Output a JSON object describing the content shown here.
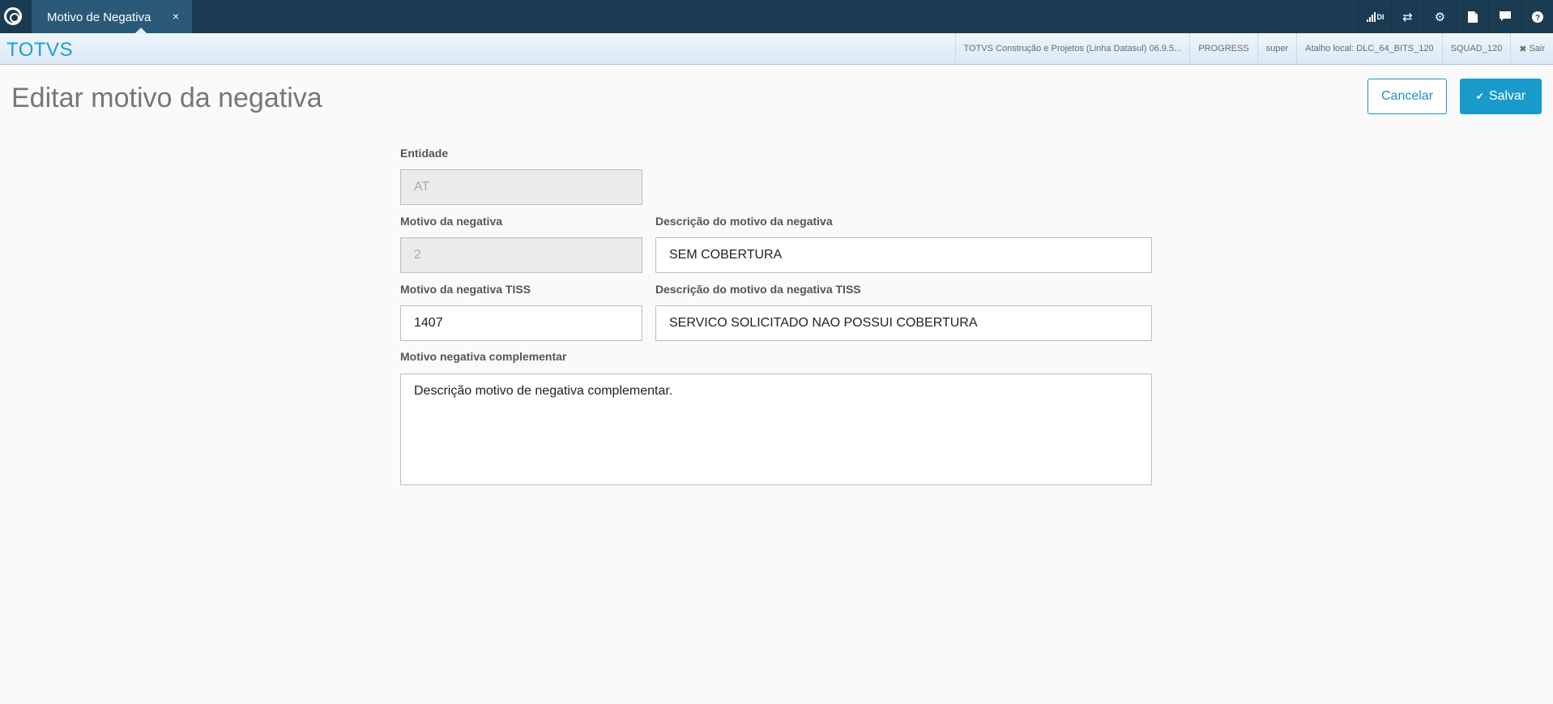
{
  "tabbar": {
    "tab_label": "Motivo de Negativa",
    "tab_close": "×",
    "icons": [
      "signal-icon",
      "shuffle-icon",
      "gear-icon",
      "document-icon",
      "chat-icon",
      "help-icon"
    ],
    "signal_text": "DI"
  },
  "header": {
    "brand": "TOTVS",
    "product": "TOTVS Construção e Projetos (Linha Datasul) 06.9.5...",
    "database": "PROGRESS",
    "user": "super",
    "shortcut": "Atalho local: DLC_64_BITS_120",
    "squad": "SQUAD_120",
    "logout": "Sair"
  },
  "page": {
    "title": "Editar motivo da negativa",
    "cancel_label": "Cancelar",
    "save_label": "Salvar"
  },
  "form": {
    "entidade_label": "Entidade",
    "entidade_value": "AT",
    "motivo_label": "Motivo da negativa",
    "motivo_value": "2",
    "descricao_label": "Descrição do motivo da negativa",
    "descricao_value": "SEM COBERTURA",
    "motivo_tiss_label": "Motivo da negativa TISS",
    "motivo_tiss_value": "1407",
    "descricao_tiss_label": "Descrição do motivo da negativa TISS",
    "descricao_tiss_value": "SERVICO SOLICITADO NAO POSSUI COBERTURA",
    "complementar_label": "Motivo negativa complementar",
    "complementar_value": "Descrição motivo de negativa complementar."
  },
  "colors": {
    "topbar": "#1b3b52",
    "active_tab": "#2b5a78",
    "brand": "#1aa0d0",
    "primary": "#1a9acb"
  }
}
